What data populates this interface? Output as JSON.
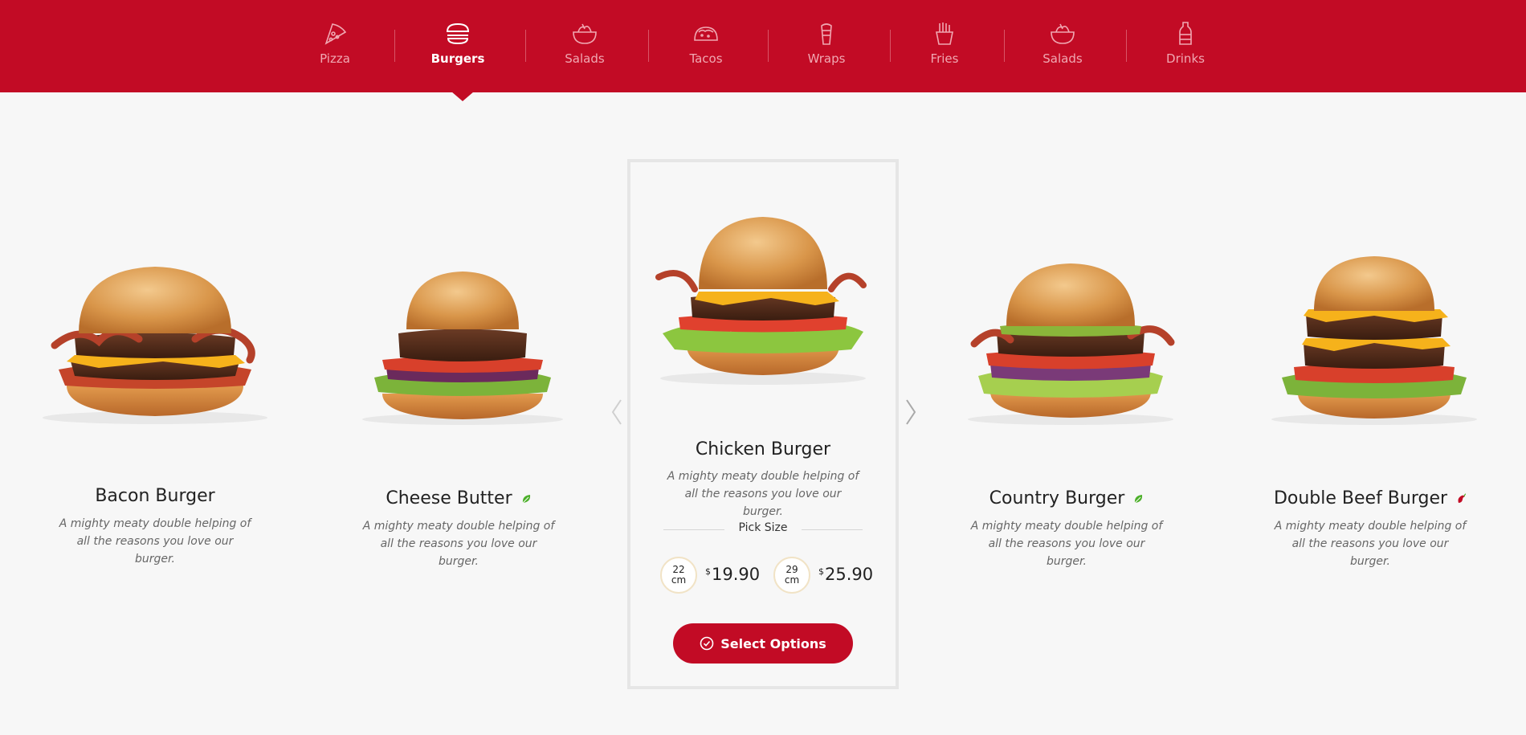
{
  "nav": {
    "items": [
      {
        "label": "Pizza",
        "icon": "pizza-icon"
      },
      {
        "label": "Burgers",
        "icon": "burger-icon",
        "active": true
      },
      {
        "label": "Salads",
        "icon": "salad-bowl-icon"
      },
      {
        "label": "Tacos",
        "icon": "taco-icon"
      },
      {
        "label": "Wraps",
        "icon": "wrap-icon"
      },
      {
        "label": "Fries",
        "icon": "fries-icon"
      },
      {
        "label": "Salads",
        "icon": "salad-bowl-icon"
      },
      {
        "label": "Drinks",
        "icon": "bottle-icon"
      }
    ]
  },
  "products": [
    {
      "name": "Bacon Burger",
      "desc": "A mighty meaty double helping of all the reasons you love our burger.",
      "badge": ""
    },
    {
      "name": "Cheese Butter",
      "desc": "A mighty meaty double helping of all the reasons you love our burger.",
      "badge": "vegetarian-leaf-icon"
    },
    {
      "name": "Chicken Burger",
      "desc": "A mighty meaty double helping of all the reasons you love our burger.",
      "badge": ""
    },
    {
      "name": "Country Burger",
      "desc": "A mighty meaty double helping of all the reasons you love our burger.",
      "badge": "vegetarian-leaf-icon"
    },
    {
      "name": "Double Beef Burger",
      "desc": "A mighty meaty double helping of all the reasons you love our burger.",
      "badge": "spicy-chili-icon"
    }
  ],
  "featured": {
    "pick_size_label": "Pick Size",
    "sizes": [
      {
        "size": "22",
        "unit": "cm",
        "currency": "$",
        "price": "19.90"
      },
      {
        "size": "29",
        "unit": "cm",
        "currency": "$",
        "price": "25.90"
      }
    ],
    "button_label": "Select Options"
  },
  "colors": {
    "brand_red": "#c20b25",
    "background": "#f7f7f7",
    "leaf_green": "#4caf2a"
  }
}
